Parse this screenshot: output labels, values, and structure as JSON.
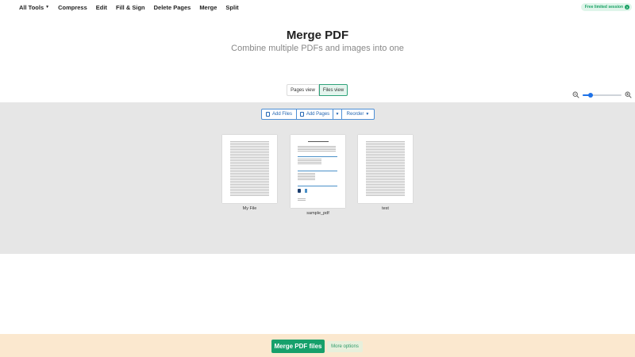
{
  "nav": {
    "items": [
      "All Tools",
      "Compress",
      "Edit",
      "Fill & Sign",
      "Delete Pages",
      "Merge",
      "Split"
    ],
    "badge": "Free limited session",
    "badge_help": "?"
  },
  "header": {
    "title": "Merge PDF",
    "subtitle": "Combine multiple PDFs and images into one"
  },
  "view_toggle": {
    "pages_label": "Pages view",
    "files_label": "Files view",
    "selected": "Files view"
  },
  "zoom": {
    "level": 0.2
  },
  "toolbar": {
    "add_files": "Add Files",
    "add_pages": "Add Pages",
    "reorder": "Reorder"
  },
  "files": [
    {
      "name": "My File"
    },
    {
      "name": "sample_pdf"
    },
    {
      "name": "test"
    }
  ],
  "footer": {
    "merge_label": "Merge PDF files",
    "more_label": "More options"
  },
  "colors": {
    "accent_green": "#16a06b",
    "accent_blue": "#1e72e8",
    "workspace_bg": "#e6e6e6",
    "footer_bg": "#fbe8cf"
  }
}
